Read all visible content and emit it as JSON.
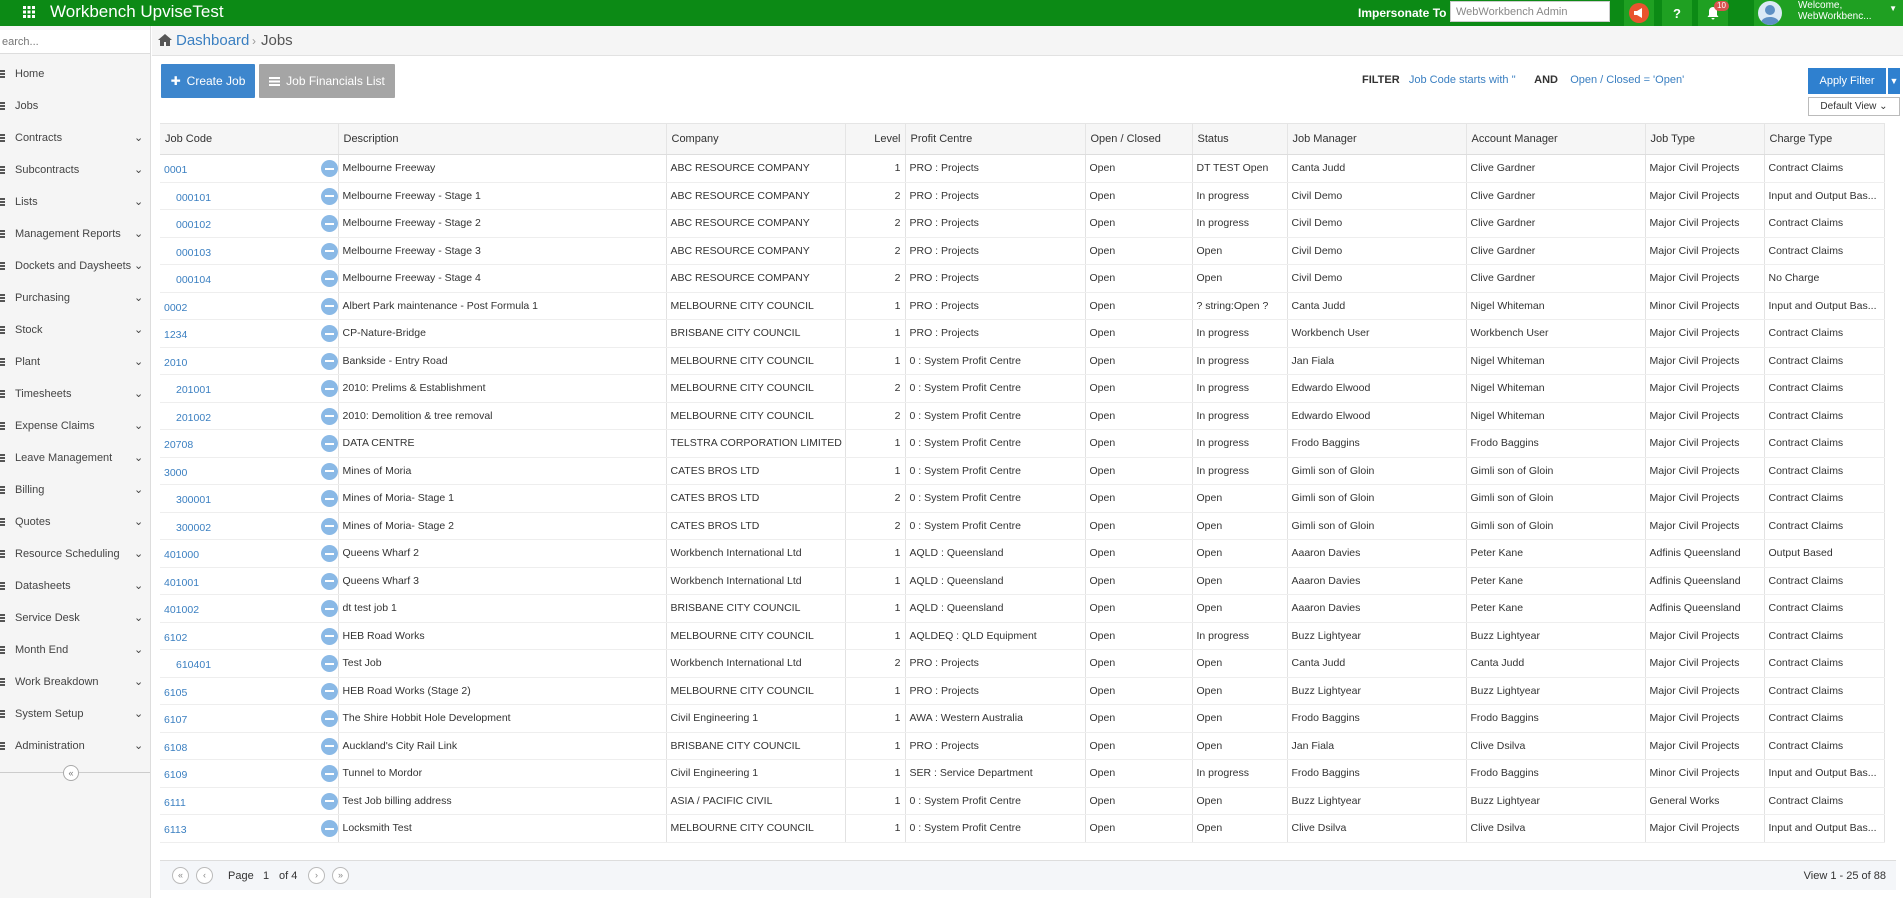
{
  "app": {
    "title": "Workbench UpviseTest"
  },
  "topbar": {
    "impersonate_label": "Impersonate To",
    "impersonate_value": "WebWorkbench Admin",
    "help_label": "?",
    "notification_count": "10",
    "user_welcome": "Welcome,",
    "user_name": "WebWorkbenc..."
  },
  "sidebar": {
    "search_placeholder": "earch...",
    "items": [
      {
        "label": "Home",
        "icon": "home-icon",
        "expandable": false
      },
      {
        "label": "Jobs",
        "icon": "list-icon",
        "expandable": false
      },
      {
        "label": "Contracts",
        "icon": "contract-icon",
        "expandable": true
      },
      {
        "label": "Subcontracts",
        "icon": "subcontract-icon",
        "expandable": true
      },
      {
        "label": "Lists",
        "icon": "list-icon",
        "expandable": true
      },
      {
        "label": "Management Reports",
        "icon": "chart-icon",
        "expandable": true
      },
      {
        "label": "Dockets and Daysheets",
        "icon": "docket-icon",
        "expandable": true
      },
      {
        "label": "Purchasing",
        "icon": "cart-icon",
        "expandable": true
      },
      {
        "label": "Stock",
        "icon": "stock-icon",
        "expandable": true
      },
      {
        "label": "Plant",
        "icon": "plant-icon",
        "expandable": true
      },
      {
        "label": "Timesheets",
        "icon": "clock-icon",
        "expandable": true
      },
      {
        "label": "Expense Claims",
        "icon": "expense-icon",
        "expandable": true
      },
      {
        "label": "Leave Management",
        "icon": "leave-icon",
        "expandable": true
      },
      {
        "label": "Billing",
        "icon": "billing-icon",
        "expandable": true
      },
      {
        "label": "Quotes",
        "icon": "quotes-icon",
        "expandable": true
      },
      {
        "label": "Resource Scheduling",
        "icon": "calendar-icon",
        "expandable": true
      },
      {
        "label": "Datasheets",
        "icon": "datasheet-icon",
        "expandable": true
      },
      {
        "label": "Service Desk",
        "icon": "service-icon",
        "expandable": true
      },
      {
        "label": "Month End",
        "icon": "month-icon",
        "expandable": true
      },
      {
        "label": "Work Breakdown",
        "icon": "breakdown-icon",
        "expandable": true
      },
      {
        "label": "System Setup",
        "icon": "setup-icon",
        "expandable": true
      },
      {
        "label": "Administration",
        "icon": "admin-icon",
        "expandable": true
      }
    ],
    "collapse_glyph": "«"
  },
  "breadcrumb": {
    "root": "Dashboard",
    "separator": "›",
    "current": "Jobs"
  },
  "toolbar": {
    "create_job": "Create Job",
    "job_financials": "Job Financials List",
    "filter_label": "FILTER",
    "filter_condition_1": "Job Code starts with ''",
    "filter_and": "AND",
    "filter_condition_2": "Open / Closed = 'Open'",
    "apply_filter": "Apply Filter",
    "default_view": "Default View"
  },
  "table": {
    "columns": [
      "Job Code",
      "Description",
      "Company",
      "Level",
      "Profit Centre",
      "Open / Closed",
      "Status",
      "Job Manager",
      "Account Manager",
      "Job Type",
      "Charge Type"
    ],
    "rows": [
      {
        "code": "0001",
        "indent": 0,
        "description": "Melbourne Freeway",
        "company": "ABC RESOURCE COMPANY",
        "level": "1",
        "profit_centre": "PRO : Projects",
        "open_closed": "Open",
        "status": "DT TEST Open",
        "job_manager": "Canta Judd",
        "account_manager": "Clive Gardner",
        "job_type": "Major Civil Projects",
        "charge_type": "Contract Claims"
      },
      {
        "code": "000101",
        "indent": 1,
        "description": "Melbourne Freeway - Stage 1",
        "company": "ABC RESOURCE COMPANY",
        "level": "2",
        "profit_centre": "PRO : Projects",
        "open_closed": "Open",
        "status": "In progress",
        "job_manager": "Civil Demo",
        "account_manager": "Clive Gardner",
        "job_type": "Major Civil Projects",
        "charge_type": "Input and Output Bas..."
      },
      {
        "code": "000102",
        "indent": 1,
        "description": "Melbourne Freeway - Stage 2",
        "company": "ABC RESOURCE COMPANY",
        "level": "2",
        "profit_centre": "PRO : Projects",
        "open_closed": "Open",
        "status": "In progress",
        "job_manager": "Civil Demo",
        "account_manager": "Clive Gardner",
        "job_type": "Major Civil Projects",
        "charge_type": "Contract Claims"
      },
      {
        "code": "000103",
        "indent": 1,
        "description": "Melbourne Freeway - Stage 3",
        "company": "ABC RESOURCE COMPANY",
        "level": "2",
        "profit_centre": "PRO : Projects",
        "open_closed": "Open",
        "status": "Open",
        "job_manager": "Civil Demo",
        "account_manager": "Clive Gardner",
        "job_type": "Major Civil Projects",
        "charge_type": "Contract Claims"
      },
      {
        "code": "000104",
        "indent": 1,
        "description": "Melbourne Freeway - Stage 4",
        "company": "ABC RESOURCE COMPANY",
        "level": "2",
        "profit_centre": "PRO : Projects",
        "open_closed": "Open",
        "status": "Open",
        "job_manager": "Civil Demo",
        "account_manager": "Clive Gardner",
        "job_type": "Major Civil Projects",
        "charge_type": "No Charge"
      },
      {
        "code": "0002",
        "indent": 0,
        "description": "Albert Park maintenance - Post Formula 1",
        "company": "MELBOURNE CITY COUNCIL",
        "level": "1",
        "profit_centre": "PRO : Projects",
        "open_closed": "Open",
        "status": "? string:Open ?",
        "job_manager": "Canta Judd",
        "account_manager": "Nigel Whiteman",
        "job_type": "Minor Civil Projects",
        "charge_type": "Input and Output Bas..."
      },
      {
        "code": "1234",
        "indent": 0,
        "description": "CP-Nature-Bridge",
        "company": "BRISBANE CITY COUNCIL",
        "level": "1",
        "profit_centre": "PRO : Projects",
        "open_closed": "Open",
        "status": "In progress",
        "job_manager": "Workbench User",
        "account_manager": "Workbench User",
        "job_type": "Major Civil Projects",
        "charge_type": "Contract Claims"
      },
      {
        "code": "2010",
        "indent": 0,
        "description": "Bankside - Entry Road",
        "company": "MELBOURNE CITY COUNCIL",
        "level": "1",
        "profit_centre": "0 : System Profit Centre",
        "open_closed": "Open",
        "status": "In progress",
        "job_manager": "Jan Fiala",
        "account_manager": "Nigel Whiteman",
        "job_type": "Major Civil Projects",
        "charge_type": "Contract Claims"
      },
      {
        "code": "201001",
        "indent": 1,
        "description": "2010: Prelims & Establishment",
        "company": "MELBOURNE CITY COUNCIL",
        "level": "2",
        "profit_centre": "0 : System Profit Centre",
        "open_closed": "Open",
        "status": "In progress",
        "job_manager": "Edwardo Elwood",
        "account_manager": "Nigel Whiteman",
        "job_type": "Major Civil Projects",
        "charge_type": "Contract Claims"
      },
      {
        "code": "201002",
        "indent": 1,
        "description": "2010: Demolition & tree removal",
        "company": "MELBOURNE CITY COUNCIL",
        "level": "2",
        "profit_centre": "0 : System Profit Centre",
        "open_closed": "Open",
        "status": "In progress",
        "job_manager": "Edwardo Elwood",
        "account_manager": "Nigel Whiteman",
        "job_type": "Major Civil Projects",
        "charge_type": "Contract Claims"
      },
      {
        "code": "20708",
        "indent": 0,
        "description": "DATA CENTRE",
        "company": "TELSTRA CORPORATION LIMITED",
        "level": "1",
        "profit_centre": "0 : System Profit Centre",
        "open_closed": "Open",
        "status": "In progress",
        "job_manager": "Frodo Baggins",
        "account_manager": "Frodo Baggins",
        "job_type": "Major Civil Projects",
        "charge_type": "Contract Claims"
      },
      {
        "code": "3000",
        "indent": 0,
        "description": "Mines of Moria",
        "company": "CATES BROS LTD",
        "level": "1",
        "profit_centre": "0 : System Profit Centre",
        "open_closed": "Open",
        "status": "In progress",
        "job_manager": "Gimli son of Gloin",
        "account_manager": "Gimli son of Gloin",
        "job_type": "Major Civil Projects",
        "charge_type": "Contract Claims"
      },
      {
        "code": "300001",
        "indent": 1,
        "description": "Mines of Moria- Stage 1",
        "company": "CATES BROS LTD",
        "level": "2",
        "profit_centre": "0 : System Profit Centre",
        "open_closed": "Open",
        "status": "Open",
        "job_manager": "Gimli son of Gloin",
        "account_manager": "Gimli son of Gloin",
        "job_type": "Major Civil Projects",
        "charge_type": "Contract Claims"
      },
      {
        "code": "300002",
        "indent": 1,
        "description": "Mines of Moria- Stage 2",
        "company": "CATES BROS LTD",
        "level": "2",
        "profit_centre": "0 : System Profit Centre",
        "open_closed": "Open",
        "status": "Open",
        "job_manager": "Gimli son of Gloin",
        "account_manager": "Gimli son of Gloin",
        "job_type": "Major Civil Projects",
        "charge_type": "Contract Claims"
      },
      {
        "code": "401000",
        "indent": 0,
        "description": "Queens Wharf 2",
        "company": "Workbench International Ltd",
        "level": "1",
        "profit_centre": "AQLD : Queensland",
        "open_closed": "Open",
        "status": "Open",
        "job_manager": "Aaaron Davies",
        "account_manager": "Peter Kane",
        "job_type": "Adfinis Queensland",
        "charge_type": "Output Based"
      },
      {
        "code": "401001",
        "indent": 0,
        "description": "Queens Wharf 3",
        "company": "Workbench International Ltd",
        "level": "1",
        "profit_centre": "AQLD : Queensland",
        "open_closed": "Open",
        "status": "Open",
        "job_manager": "Aaaron Davies",
        "account_manager": "Peter Kane",
        "job_type": "Adfinis Queensland",
        "charge_type": "Contract Claims"
      },
      {
        "code": "401002",
        "indent": 0,
        "description": "dt test job 1",
        "company": "BRISBANE CITY COUNCIL",
        "level": "1",
        "profit_centre": "AQLD : Queensland",
        "open_closed": "Open",
        "status": "Open",
        "job_manager": "Aaaron Davies",
        "account_manager": "Peter Kane",
        "job_type": "Adfinis Queensland",
        "charge_type": "Contract Claims"
      },
      {
        "code": "6102",
        "indent": 0,
        "description": "HEB Road Works",
        "company": "MELBOURNE CITY COUNCIL",
        "level": "1",
        "profit_centre": "AQLDEQ : QLD Equipment",
        "open_closed": "Open",
        "status": "In progress",
        "job_manager": "Buzz Lightyear",
        "account_manager": "Buzz Lightyear",
        "job_type": "Major Civil Projects",
        "charge_type": "Contract Claims"
      },
      {
        "code": "610401",
        "indent": 1,
        "description": "Test Job",
        "company": "Workbench International Ltd",
        "level": "2",
        "profit_centre": "PRO : Projects",
        "open_closed": "Open",
        "status": "Open",
        "job_manager": "Canta Judd",
        "account_manager": "Canta Judd",
        "job_type": "Major Civil Projects",
        "charge_type": "Contract Claims"
      },
      {
        "code": "6105",
        "indent": 0,
        "description": "HEB Road Works (Stage 2)",
        "company": "MELBOURNE CITY COUNCIL",
        "level": "1",
        "profit_centre": "PRO : Projects",
        "open_closed": "Open",
        "status": "Open",
        "job_manager": "Buzz Lightyear",
        "account_manager": "Buzz Lightyear",
        "job_type": "Major Civil Projects",
        "charge_type": "Contract Claims"
      },
      {
        "code": "6107",
        "indent": 0,
        "description": "The Shire Hobbit Hole Development",
        "company": "Civil Engineering 1",
        "level": "1",
        "profit_centre": "AWA : Western Australia",
        "open_closed": "Open",
        "status": "Open",
        "job_manager": "Frodo Baggins",
        "account_manager": "Frodo Baggins",
        "job_type": "Major Civil Projects",
        "charge_type": "Contract Claims"
      },
      {
        "code": "6108",
        "indent": 0,
        "description": "Auckland's City Rail Link",
        "company": "BRISBANE CITY COUNCIL",
        "level": "1",
        "profit_centre": "PRO : Projects",
        "open_closed": "Open",
        "status": "Open",
        "job_manager": "Jan Fiala",
        "account_manager": "Clive Dsilva",
        "job_type": "Major Civil Projects",
        "charge_type": "Contract Claims"
      },
      {
        "code": "6109",
        "indent": 0,
        "description": "Tunnel to Mordor",
        "company": "Civil Engineering 1",
        "level": "1",
        "profit_centre": "SER : Service Department",
        "open_closed": "Open",
        "status": "In progress",
        "job_manager": "Frodo Baggins",
        "account_manager": "Frodo Baggins",
        "job_type": "Minor Civil Projects",
        "charge_type": "Input and Output Bas..."
      },
      {
        "code": "6111",
        "indent": 0,
        "description": "Test Job billing address",
        "company": "ASIA / PACIFIC CIVIL",
        "level": "1",
        "profit_centre": "0 : System Profit Centre",
        "open_closed": "Open",
        "status": "Open",
        "job_manager": "Buzz Lightyear",
        "account_manager": "Buzz Lightyear",
        "job_type": "General Works",
        "charge_type": "Contract Claims"
      },
      {
        "code": "6113",
        "indent": 0,
        "description": "Locksmith Test",
        "company": "MELBOURNE CITY COUNCIL",
        "level": "1",
        "profit_centre": "0 : System Profit Centre",
        "open_closed": "Open",
        "status": "Open",
        "job_manager": "Clive Dsilva",
        "account_manager": "Clive Dsilva",
        "job_type": "Major Civil Projects",
        "charge_type": "Input and Output Bas..."
      }
    ]
  },
  "pager": {
    "page_label": "Page",
    "page_value": "1",
    "of_label": "of 4",
    "view_text": "View 1 - 25 of 88"
  },
  "colors": {
    "topbar": "#0c8a15",
    "primary": "#3d86cd",
    "link": "#3a7fc1",
    "notify": "#e9542f"
  }
}
